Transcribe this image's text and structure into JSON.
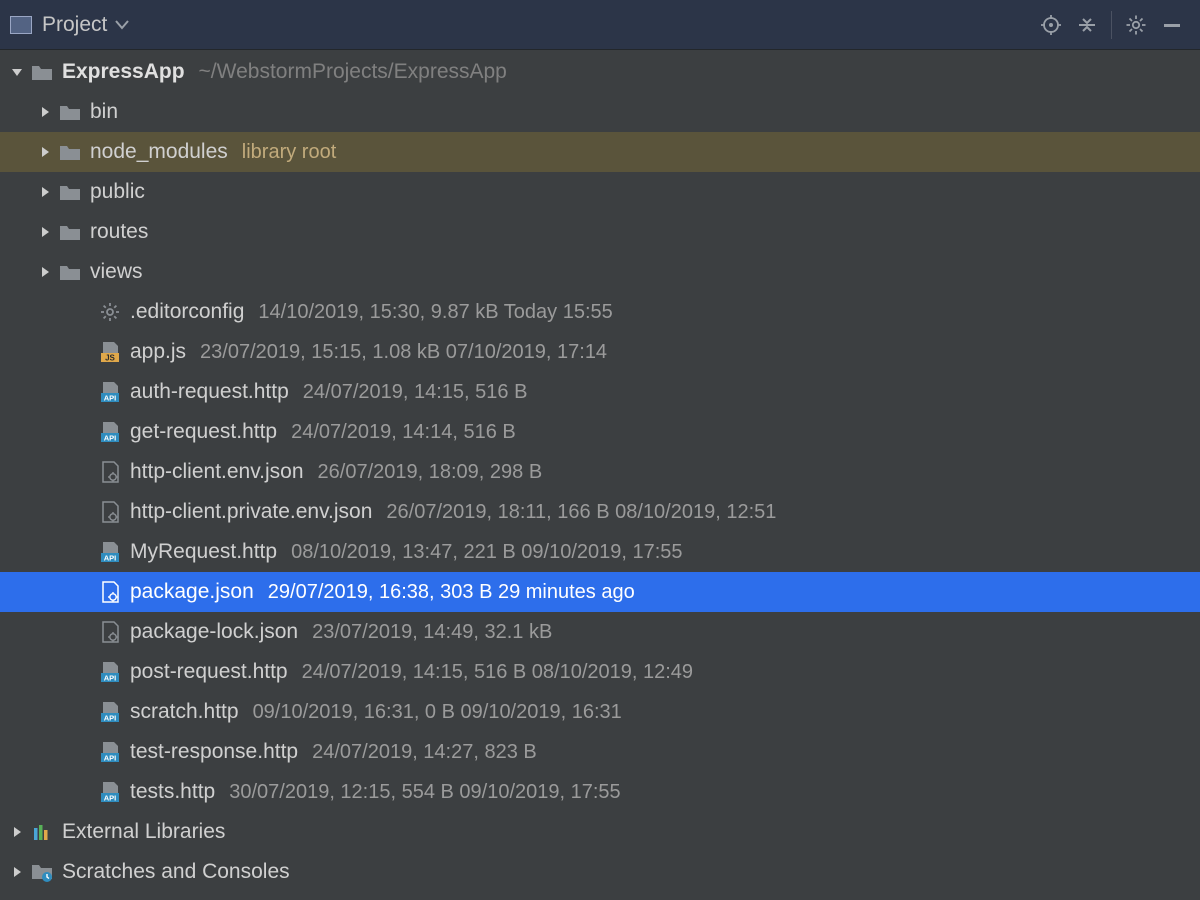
{
  "header": {
    "title": "Project"
  },
  "root": {
    "name": "ExpressApp",
    "path": "~/WebstormProjects/ExpressApp"
  },
  "folders": [
    {
      "name": "bin",
      "tag": "",
      "highlight": false
    },
    {
      "name": "node_modules",
      "tag": "library root",
      "highlight": true
    },
    {
      "name": "public",
      "tag": "",
      "highlight": false
    },
    {
      "name": "routes",
      "tag": "",
      "highlight": false
    },
    {
      "name": "views",
      "tag": "",
      "highlight": false
    }
  ],
  "files": [
    {
      "name": ".editorconfig",
      "icon": "gear",
      "meta": "14/10/2019, 15:30, 9.87 kB Today 15:55"
    },
    {
      "name": "app.js",
      "icon": "js",
      "meta": "23/07/2019, 15:15, 1.08 kB 07/10/2019, 17:14"
    },
    {
      "name": "auth-request.http",
      "icon": "api",
      "meta": "24/07/2019, 14:15, 516 B"
    },
    {
      "name": "get-request.http",
      "icon": "api",
      "meta": "24/07/2019, 14:14, 516 B"
    },
    {
      "name": "http-client.env.json",
      "icon": "jsoncfg",
      "meta": "26/07/2019, 18:09, 298 B"
    },
    {
      "name": "http-client.private.env.json",
      "icon": "jsoncfg",
      "meta": "26/07/2019, 18:11, 166 B 08/10/2019, 12:51"
    },
    {
      "name": "MyRequest.http",
      "icon": "api",
      "meta": "08/10/2019, 13:47, 221 B 09/10/2019, 17:55"
    },
    {
      "name": "package.json",
      "icon": "jsoncfg",
      "meta": "29/07/2019, 16:38, 303 B 29 minutes ago",
      "selected": true
    },
    {
      "name": "package-lock.json",
      "icon": "jsoncfg",
      "meta": "23/07/2019, 14:49, 32.1 kB"
    },
    {
      "name": "post-request.http",
      "icon": "api",
      "meta": "24/07/2019, 14:15, 516 B 08/10/2019, 12:49"
    },
    {
      "name": "scratch.http",
      "icon": "api",
      "meta": "09/10/2019, 16:31, 0 B 09/10/2019, 16:31"
    },
    {
      "name": "test-response.http",
      "icon": "api",
      "meta": "24/07/2019, 14:27, 823 B"
    },
    {
      "name": "tests.http",
      "icon": "api",
      "meta": "30/07/2019, 12:15, 554 B 09/10/2019, 17:55"
    }
  ],
  "bottom": [
    {
      "name": "External Libraries",
      "icon": "libs"
    },
    {
      "name": "Scratches and Consoles",
      "icon": "scratch"
    }
  ]
}
